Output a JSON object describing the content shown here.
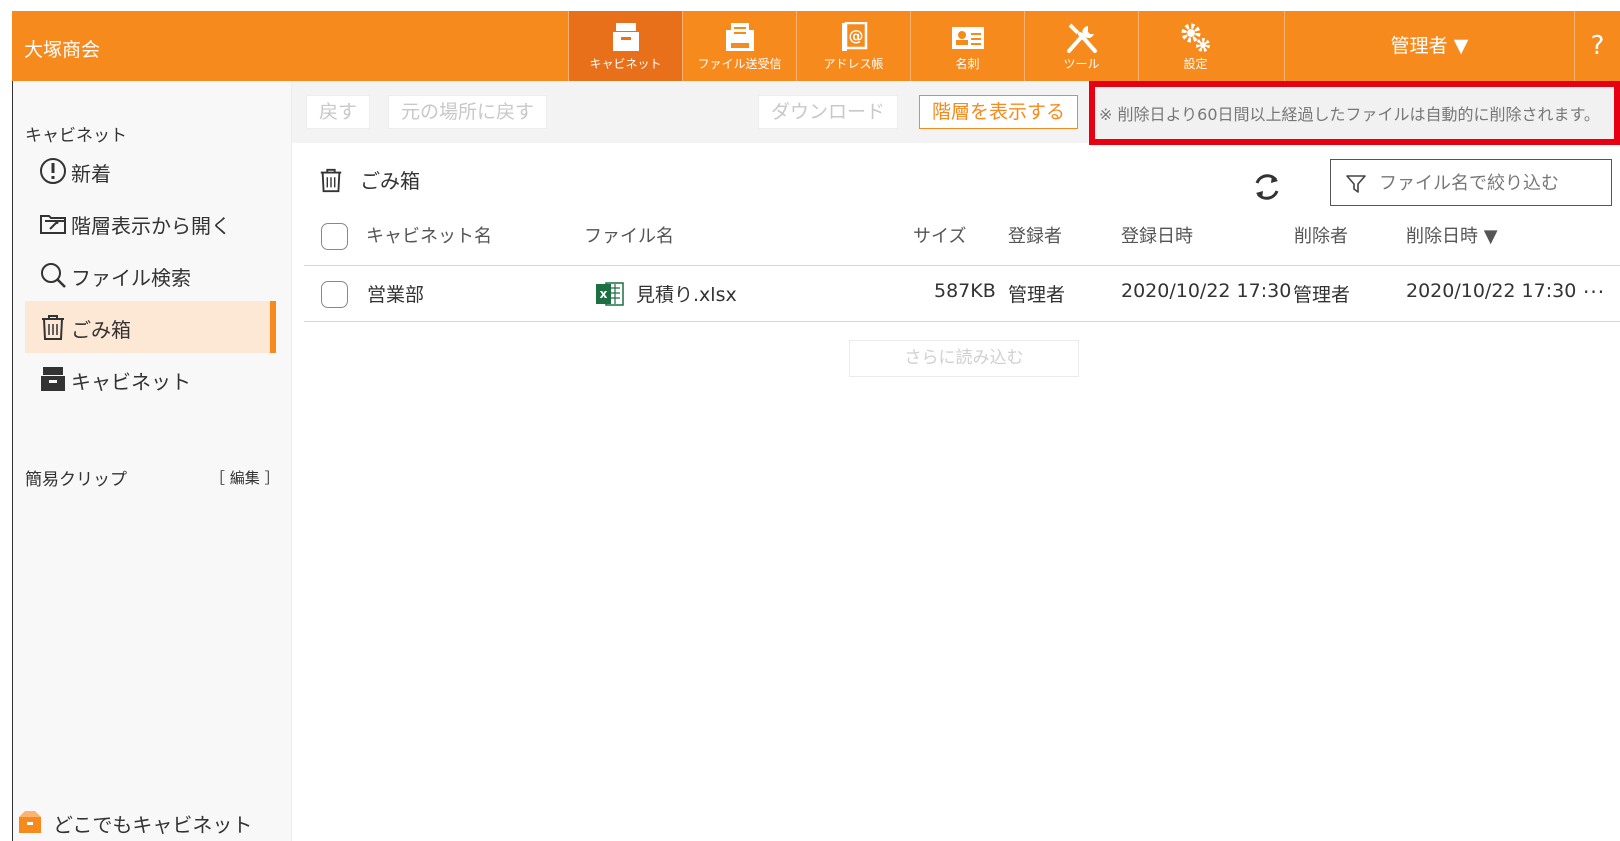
{
  "header": {
    "brand": "大塚商会",
    "nav": [
      {
        "label": "キャビネット",
        "icon": "cabinet-icon",
        "active": true
      },
      {
        "label": "ファイル送受信",
        "icon": "file-transfer-icon",
        "active": false
      },
      {
        "label": "アドレス帳",
        "icon": "address-book-icon",
        "active": false
      },
      {
        "label": "名刺",
        "icon": "business-card-icon",
        "active": false
      },
      {
        "label": "ツール",
        "icon": "tools-icon",
        "active": false
      },
      {
        "label": "設定",
        "icon": "gear-icon",
        "active": false
      }
    ],
    "user": "管理者 ▼",
    "help": "?"
  },
  "sidebar": {
    "heading": "キャビネット",
    "items": [
      {
        "label": "新着",
        "icon": "exclamation-circle-icon"
      },
      {
        "label": "階層表示から開く",
        "icon": "folder-open-icon"
      },
      {
        "label": "ファイル検索",
        "icon": "search-icon"
      },
      {
        "label": "ごみ箱",
        "icon": "trash-icon",
        "active": true
      },
      {
        "label": "キャビネット",
        "icon": "cabinet-icon"
      }
    ],
    "clip_label": "簡易クリップ",
    "clip_edit": "［ 編集 ］",
    "anywhere": "どこでもキャビネット"
  },
  "toolbar": {
    "back": "戻す",
    "restore": "元の場所に戻す",
    "download": "ダウンロード",
    "show_hierarchy": "階層を表示する",
    "notice": "※ 削除日より60日間以上経過したファイルは自動的に削除されます。"
  },
  "main": {
    "title": "ごみ箱",
    "filter_placeholder": "ファイル名で絞り込む",
    "columns": [
      "キャビネット名",
      "ファイル名",
      "サイズ",
      "登録者",
      "登録日時",
      "削除者",
      "削除日時 ▼"
    ],
    "rows": [
      {
        "cabinet": "営業部",
        "file": "見積り.xlsx",
        "size": "587KB",
        "registrant": "管理者",
        "registered_at": "2020/10/22 17:30",
        "deleter": "管理者",
        "deleted_at": "2020/10/22 17:30",
        "more": "···"
      }
    ],
    "load_more": "さらに読み込む"
  },
  "colors": {
    "accent": "#f78a1d",
    "accent_dark": "#e8701a",
    "highlight_border": "#e60012",
    "excel_green": "#1d6f42"
  }
}
